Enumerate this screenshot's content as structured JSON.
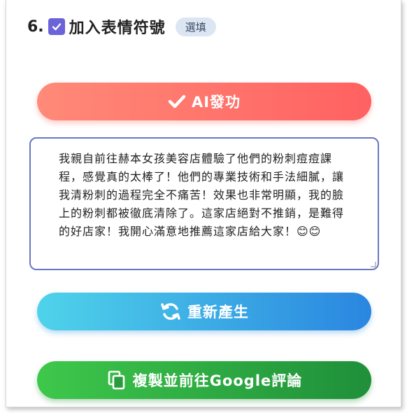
{
  "question": {
    "number": "6.",
    "checked": true,
    "title": "加入表情符號",
    "badge": "選填"
  },
  "buttons": {
    "ai_label": "AI發功",
    "regenerate_label": "重新產生",
    "copy_label": "複製並前往Google評論"
  },
  "review": {
    "text": "我親自前往赫本女孩美容店體驗了他們的粉刺痘痘課程，感覺真的太棒了！他們的專業技術和手法細膩，讓我清粉刺的過程完全不痛苦！效果也非常明顯，我的臉上的粉刺都被徹底清除了。這家店絕對不推銷，是難得的好店家！我開心滿意地推薦這家店給大家！😊😊"
  },
  "colors": {
    "checkbox": "#6b63d8",
    "ai_button": "#ff6f6a",
    "regenerate_button": "#3aa8e6",
    "copy_button": "#2fae44",
    "textarea_border": "#6a76c2"
  },
  "icons": {
    "checkbox": "check-icon",
    "ai": "check-mark-icon",
    "regenerate": "refresh-icon",
    "copy": "copy-icon"
  }
}
